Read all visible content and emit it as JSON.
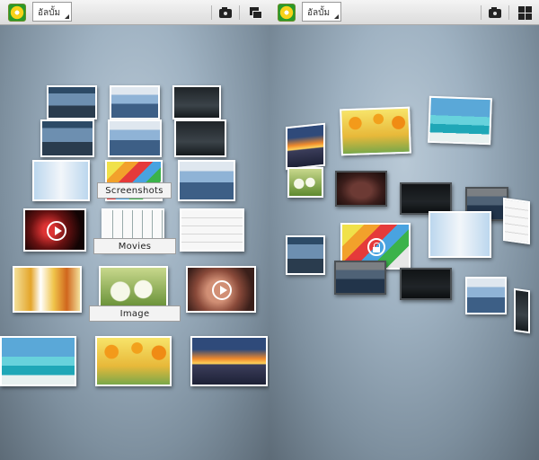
{
  "left_screen": {
    "toolbar": {
      "album_dropdown_label": "อัลบั้ม",
      "icons": [
        "gallery-app-icon",
        "camera-icon",
        "stack-view-icon"
      ]
    },
    "album_labels": {
      "screenshots": "Screenshots",
      "movies": "Movies",
      "image": "Image"
    }
  },
  "right_screen": {
    "toolbar": {
      "album_dropdown_label": "อัลบั้ม",
      "icons": [
        "gallery-app-icon",
        "camera-icon",
        "grid-view-icon"
      ]
    }
  },
  "colors": {
    "background_center": "#b9c9d6",
    "background_edge": "#5d6b77",
    "toolbar": "#e8e8e8",
    "label_bg": "#f3f3f3"
  }
}
